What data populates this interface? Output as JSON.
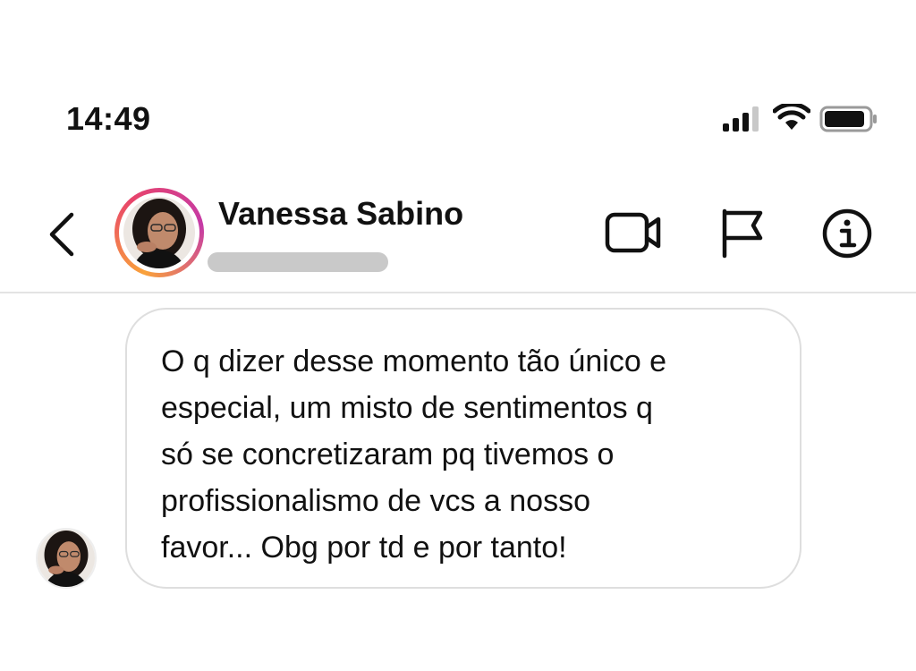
{
  "status_bar": {
    "time": "14:49",
    "icons": [
      "signal-icon",
      "wifi-icon",
      "battery-icon"
    ]
  },
  "header": {
    "back_icon": "back-chevron-icon",
    "contact_name": "Vanessa Sabino",
    "actions": [
      "video-call-icon",
      "flag-icon",
      "info-icon"
    ]
  },
  "message": {
    "text": "O q dizer desse momento tão único e\nespecial, um misto de sentimentos q\nsó se concretizaram pq tivemos o\nprofissionalismo de vcs a nosso\nfavor... Obg por td e por tanto!"
  },
  "colors": {
    "avatar_ring": [
      "#f9a23b",
      "#e8446b",
      "#c53aa6"
    ],
    "bubble_border": "#dedede",
    "divider": "#e3e3e3"
  }
}
